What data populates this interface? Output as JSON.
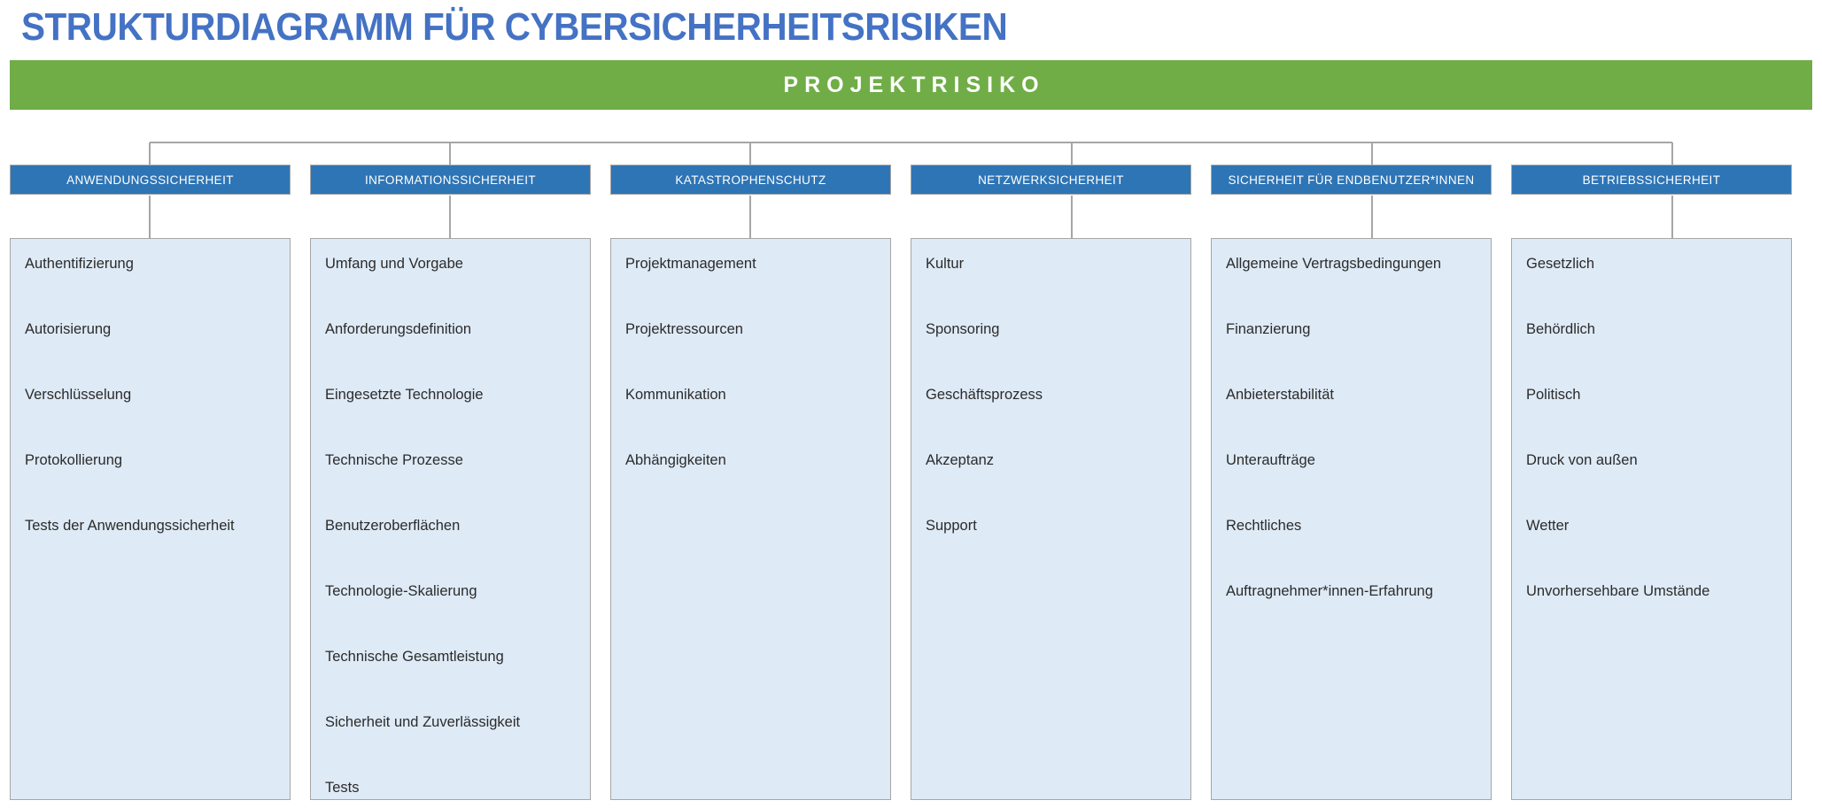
{
  "title": "STRUKTURDIAGRAMM FÜR CYBERSICHERHEITSRISIKEN",
  "colors": {
    "title_blue": "#4472C4",
    "root_green": "#70AD47",
    "header_blue": "#2E75B6",
    "panel_blue": "#DEEAF6",
    "connector_gray": "#a6a6a6",
    "leaf_text": "#2b2b2b"
  },
  "root": {
    "label": "PROJEKTRISIKO"
  },
  "columns": [
    {
      "header": "ANWENDUNGSSICHERHEIT",
      "items": [
        "Authentifizierung",
        "Autorisierung",
        "Verschlüsselung",
        "Protokollierung",
        "Tests der Anwendungssicherheit"
      ]
    },
    {
      "header": "INFORMATIONSSICHERHEIT",
      "items": [
        "Umfang und Vorgabe",
        "Anforderungsdefinition",
        "Eingesetzte Technologie",
        "Technische Prozesse",
        "Benutzeroberflächen",
        "Technologie-Skalierung",
        "Technische Gesamtleistung",
        "Sicherheit und Zuverlässigkeit",
        "Tests"
      ]
    },
    {
      "header": "KATASTROPHENSCHUTZ",
      "items": [
        "Projektmanagement",
        "Projektressourcen",
        "Kommunikation",
        "Abhängigkeiten"
      ]
    },
    {
      "header": "NETZWERKSICHERHEIT",
      "items": [
        "Kultur",
        "Sponsoring",
        "Geschäftsprozess",
        "Akzeptanz",
        "Support"
      ]
    },
    {
      "header": "SICHERHEIT FÜR ENDBENUTZER*INNEN",
      "items": [
        "Allgemeine Vertragsbedingungen",
        "Finanzierung",
        "Anbieterstabilität",
        "Unteraufträge",
        "Rechtliches",
        "Auftragnehmer*innen-Erfahrung"
      ]
    },
    {
      "header": "BETRIEBSSICHERHEIT",
      "items": [
        "Gesetzlich",
        "Behördlich",
        "Politisch",
        "Druck von außen",
        "Wetter",
        "Unvorhersehbare Umstände"
      ]
    }
  ]
}
